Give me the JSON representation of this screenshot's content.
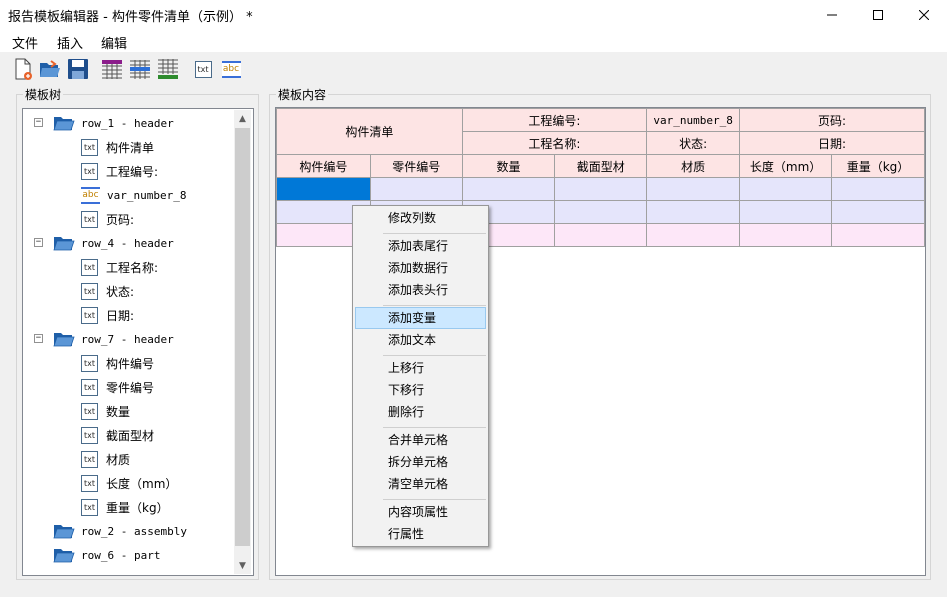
{
  "window": {
    "title": "报告模板编辑器 - 构件零件清单（示例） *",
    "min_symbol": "—",
    "max_symbol": "☐",
    "close_symbol": "✕"
  },
  "menu": [
    "文件",
    "插入",
    "编辑"
  ],
  "toolbar": {
    "buttons": [
      "new-file-icon",
      "open-folder-icon",
      "save-icon",
      "table-header-icon",
      "table-data-icon",
      "table-footer-icon",
      "text-icon",
      "variable-icon"
    ],
    "txt_label": "txt",
    "abc_label": "abc"
  },
  "tree": {
    "label": "模板树",
    "icon_txt": "txt",
    "icon_abc": "abc",
    "expander_open": "−",
    "items": [
      {
        "kind": "folder",
        "text": "row_1 - header",
        "expandable": true
      },
      {
        "kind": "txt",
        "text": "构件清单"
      },
      {
        "kind": "txt",
        "text": "工程编号:"
      },
      {
        "kind": "abc",
        "text": "var_number_8"
      },
      {
        "kind": "txt",
        "text": "页码:"
      },
      {
        "kind": "folder",
        "text": "row_4 - header",
        "expandable": true
      },
      {
        "kind": "txt",
        "text": "工程名称:"
      },
      {
        "kind": "txt",
        "text": "状态:"
      },
      {
        "kind": "txt",
        "text": "日期:"
      },
      {
        "kind": "folder",
        "text": "row_7 - header",
        "expandable": true
      },
      {
        "kind": "txt",
        "text": "构件编号"
      },
      {
        "kind": "txt",
        "text": "零件编号"
      },
      {
        "kind": "txt",
        "text": "数量"
      },
      {
        "kind": "txt",
        "text": "截面型材"
      },
      {
        "kind": "txt",
        "text": "材质"
      },
      {
        "kind": "txt",
        "text": "长度（mm）"
      },
      {
        "kind": "txt",
        "text": "重量（kg）"
      },
      {
        "kind": "folder",
        "text": "row_2 - assembly",
        "expandable": false
      },
      {
        "kind": "folder",
        "text": "row_6 - part",
        "expandable": false
      }
    ]
  },
  "content": {
    "label": "模板内容",
    "header": {
      "title": "构件清单",
      "project_no_label": "工程编号:",
      "project_no_var": "var_number_8",
      "page_label": "页码:",
      "project_name_label": "工程名称:",
      "status_label": "状态:",
      "date_label": "日期:"
    },
    "columns": [
      "构件编号",
      "零件编号",
      "数量",
      "截面型材",
      "材质",
      "长度（mm）",
      "重量（kg）"
    ]
  },
  "context_menu": {
    "items": [
      "修改列数",
      "添加表尾行",
      "添加数据行",
      "添加表头行",
      "添加变量",
      "添加文本",
      "上移行",
      "下移行",
      "删除行",
      "合并单元格",
      "拆分单元格",
      "清空单元格",
      "内容项属性",
      "行属性"
    ],
    "highlighted": "添加变量"
  }
}
